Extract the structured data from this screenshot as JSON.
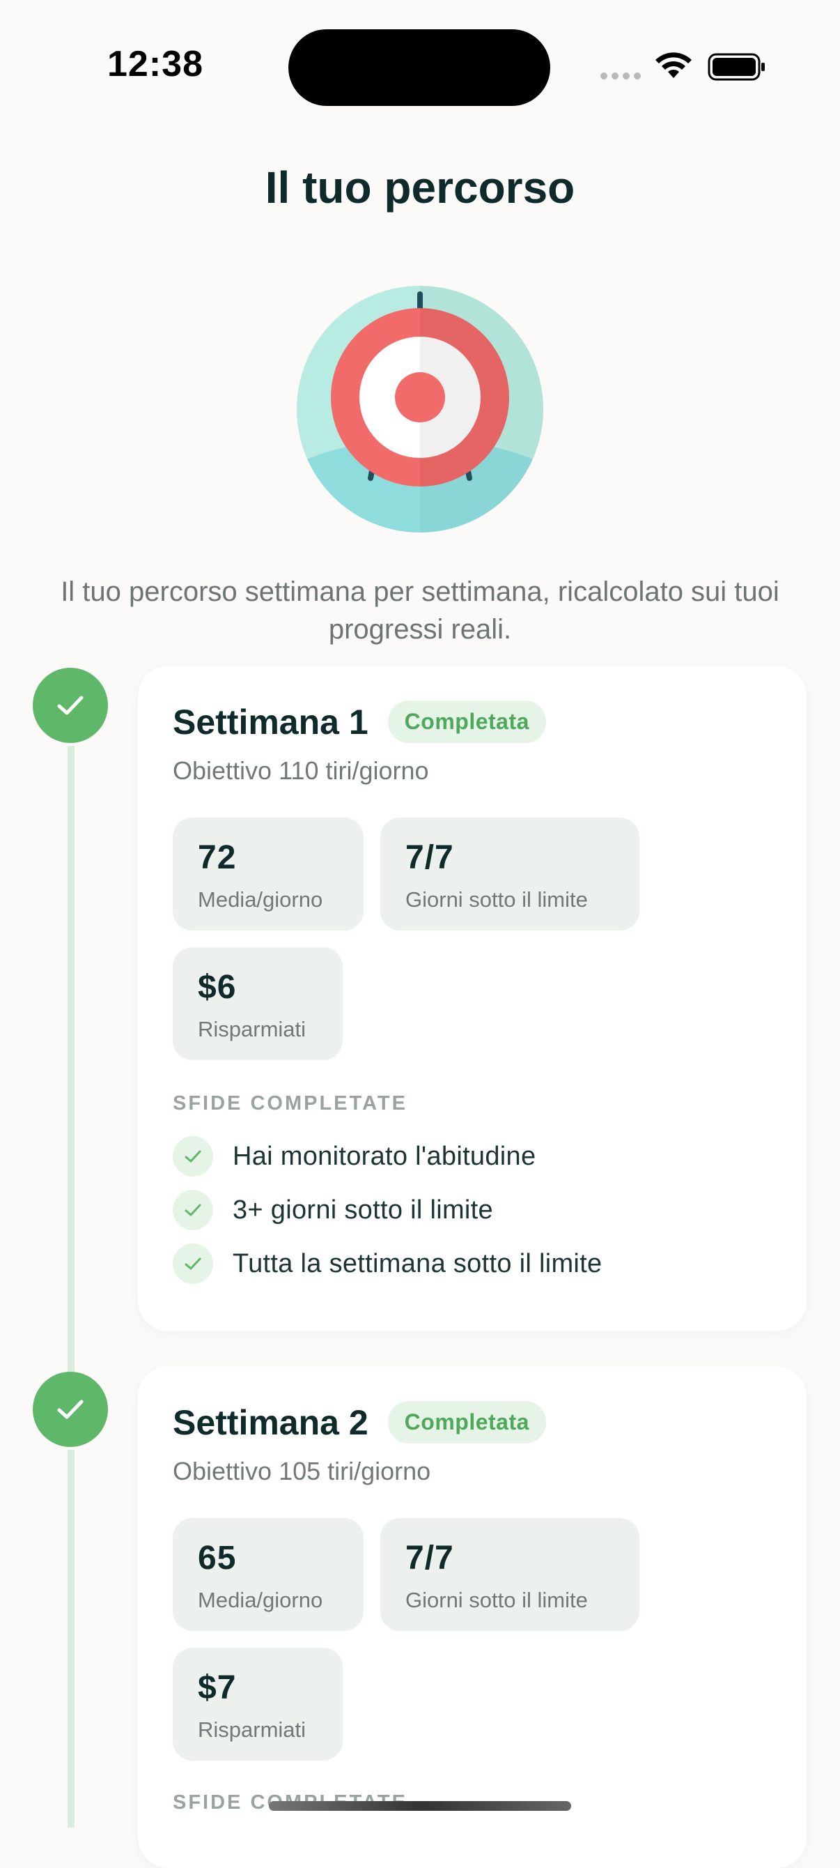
{
  "status_bar": {
    "time": "12:38"
  },
  "page": {
    "title": "Il tuo percorso",
    "intro": "Il tuo percorso settimana per settimana, ricalcolato sui tuoi progressi reali."
  },
  "weeks": [
    {
      "title": "Settimana 1",
      "badge": "Completata",
      "goal": "Obiettivo 110 tiri/giorno",
      "stats": [
        {
          "value": "72",
          "label": "Media/giorno"
        },
        {
          "value": "7/7",
          "label": "Giorni sotto il limite"
        },
        {
          "value": "$6",
          "label": "Risparmiati"
        }
      ],
      "section_label": "SFIDE COMPLETATE",
      "challenges": [
        "Hai monitorato l'abitudine",
        "3+ giorni sotto il limite",
        "Tutta la settimana sotto il limite"
      ]
    },
    {
      "title": "Settimana 2",
      "badge": "Completata",
      "goal": "Obiettivo 105 tiri/giorno",
      "stats": [
        {
          "value": "65",
          "label": "Media/giorno"
        },
        {
          "value": "7/7",
          "label": "Giorni sotto il limite"
        },
        {
          "value": "$7",
          "label": "Risparmiati"
        }
      ],
      "section_label": "SFIDE COMPLETATE"
    }
  ],
  "icons": {
    "hero": "target-icon",
    "node": "check-icon"
  },
  "colors": {
    "accent_green": "#5fb76a",
    "badge_bg": "#e6f4e7",
    "title_text": "#0f2a2a",
    "target_red": "#f26b6b",
    "target_teal": "#b8ebe1"
  }
}
